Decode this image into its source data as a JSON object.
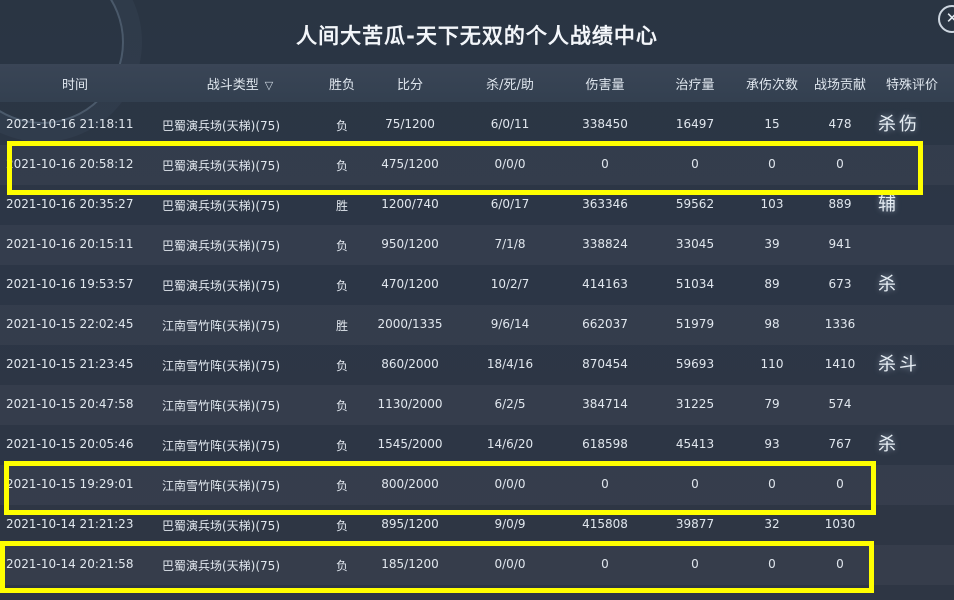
{
  "title": "人间大苦瓜-天下无双的个人战绩中心",
  "close_glyph": "✕",
  "headers": {
    "time": "时间",
    "mode": "战斗类型",
    "result": "胜负",
    "score": "比分",
    "kda": "杀/死/助",
    "damage": "伤害量",
    "heal": "治疗量",
    "hits": "承伤次数",
    "contrib": "战场贡献",
    "special": "特殊评价"
  },
  "sort_icon": "chevron-down-icon",
  "rows": [
    {
      "time": "2021-10-16 21:18:11",
      "mode": "巴蜀演兵场(天梯)(75)",
      "result": "负",
      "score": "75/1200",
      "kda": "6/0/11",
      "damage": "338450",
      "heal": "16497",
      "hits": "15",
      "contrib": "478",
      "special": "杀伤"
    },
    {
      "time": "2021-10-16 20:58:12",
      "mode": "巴蜀演兵场(天梯)(75)",
      "result": "负",
      "score": "475/1200",
      "kda": "0/0/0",
      "damage": "0",
      "heal": "0",
      "hits": "0",
      "contrib": "0",
      "special": ""
    },
    {
      "time": "2021-10-16 20:35:27",
      "mode": "巴蜀演兵场(天梯)(75)",
      "result": "胜",
      "score": "1200/740",
      "kda": "6/0/17",
      "damage": "363346",
      "heal": "59562",
      "hits": "103",
      "contrib": "889",
      "special": "辅"
    },
    {
      "time": "2021-10-16 20:15:11",
      "mode": "巴蜀演兵场(天梯)(75)",
      "result": "负",
      "score": "950/1200",
      "kda": "7/1/8",
      "damage": "338824",
      "heal": "33045",
      "hits": "39",
      "contrib": "941",
      "special": ""
    },
    {
      "time": "2021-10-16 19:53:57",
      "mode": "巴蜀演兵场(天梯)(75)",
      "result": "负",
      "score": "470/1200",
      "kda": "10/2/7",
      "damage": "414163",
      "heal": "51034",
      "hits": "89",
      "contrib": "673",
      "special": "杀"
    },
    {
      "time": "2021-10-15 22:02:45",
      "mode": "江南雪竹阵(天梯)(75)",
      "result": "胜",
      "score": "2000/1335",
      "kda": "9/6/14",
      "damage": "662037",
      "heal": "51979",
      "hits": "98",
      "contrib": "1336",
      "special": ""
    },
    {
      "time": "2021-10-15 21:23:45",
      "mode": "江南雪竹阵(天梯)(75)",
      "result": "负",
      "score": "860/2000",
      "kda": "18/4/16",
      "damage": "870454",
      "heal": "59693",
      "hits": "110",
      "contrib": "1410",
      "special": "杀斗"
    },
    {
      "time": "2021-10-15 20:47:58",
      "mode": "江南雪竹阵(天梯)(75)",
      "result": "负",
      "score": "1130/2000",
      "kda": "6/2/5",
      "damage": "384714",
      "heal": "31225",
      "hits": "79",
      "contrib": "574",
      "special": ""
    },
    {
      "time": "2021-10-15 20:05:46",
      "mode": "江南雪竹阵(天梯)(75)",
      "result": "负",
      "score": "1545/2000",
      "kda": "14/6/20",
      "damage": "618598",
      "heal": "45413",
      "hits": "93",
      "contrib": "767",
      "special": "杀"
    },
    {
      "time": "2021-10-15 19:29:01",
      "mode": "江南雪竹阵(天梯)(75)",
      "result": "负",
      "score": "800/2000",
      "kda": "0/0/0",
      "damage": "0",
      "heal": "0",
      "hits": "0",
      "contrib": "0",
      "special": ""
    },
    {
      "time": "2021-10-14 21:21:23",
      "mode": "巴蜀演兵场(天梯)(75)",
      "result": "负",
      "score": "895/1200",
      "kda": "9/0/9",
      "damage": "415808",
      "heal": "39877",
      "hits": "32",
      "contrib": "1030",
      "special": ""
    },
    {
      "time": "2021-10-14 20:21:58",
      "mode": "巴蜀演兵场(天梯)(75)",
      "result": "负",
      "score": "185/1200",
      "kda": "0/0/0",
      "damage": "0",
      "heal": "0",
      "hits": "0",
      "contrib": "0",
      "special": ""
    }
  ],
  "highlight_color": "#ffff00",
  "highlighted_rows": [
    1,
    9,
    11
  ]
}
